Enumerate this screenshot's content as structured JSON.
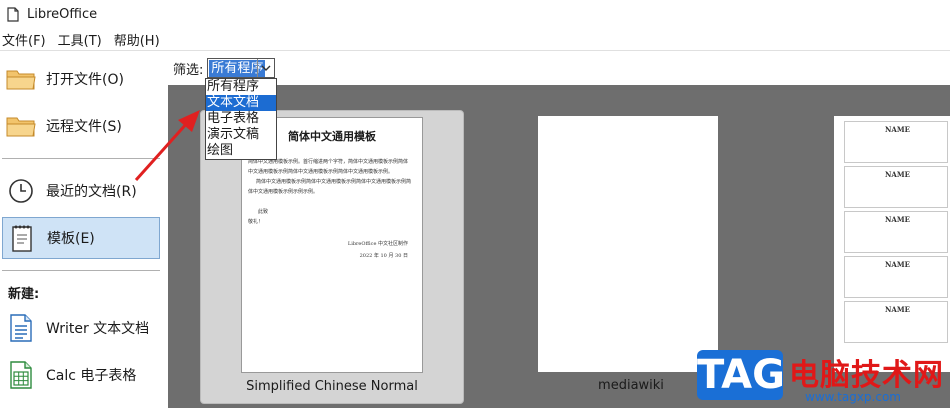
{
  "window": {
    "title": "LibreOffice"
  },
  "menubar": {
    "items": [
      "文件(F)",
      "工具(T)",
      "帮助(H)"
    ]
  },
  "sidebar": {
    "items": [
      {
        "label": "打开文件(O)",
        "icon": "folder-icon"
      },
      {
        "label": "远程文件(S)",
        "icon": "remote-folder-icon"
      },
      {
        "label": "最近的文档(R)",
        "icon": "clock-icon"
      },
      {
        "label": "模板(E)",
        "icon": "template-icon",
        "selected": true
      }
    ],
    "new_heading": "新建:",
    "new_items": [
      {
        "label": "Writer 文本文档",
        "icon": "writer-icon"
      },
      {
        "label": "Calc 电子表格",
        "icon": "calc-icon"
      }
    ]
  },
  "filter": {
    "label": "筛选:",
    "selected": "所有程序",
    "options": [
      "所有程序",
      "文本文档",
      "电子表格",
      "演示文稿",
      "绘图"
    ],
    "highlighted_index": 1
  },
  "templates": [
    {
      "name": "Simplified Chinese Normal",
      "preview": {
        "title": "简体中文通用模板",
        "lines": [
          "简体中文通用模板示例。首行缩进两个字符，简体中文通用模板示例简体",
          "中文通用模板示例简体中文通用模板示例简体中文通用模板示例。",
          "简体中文通用模板示例简体中文通用模板示例简体中文通用模板示例简",
          "体中文通用模板示例示例示例。"
        ],
        "closing_1": "此致",
        "closing_2": "敬礼！",
        "signature": "LibreOffice 中文社区制作",
        "date": "2022 年 10 月 30 日"
      }
    },
    {
      "name": "mediawiki"
    },
    {
      "name": "",
      "preview": {
        "card_title": "NAME"
      }
    }
  ],
  "watermark": {
    "logo": "TAG",
    "text": "电脑技术网",
    "url": "www.tagxp.com"
  },
  "colors": {
    "selection": "#cfe3f6",
    "highlight": "#1c6cd2",
    "gallery_bg": "#6e6e6e",
    "arrow": "#e02020"
  }
}
